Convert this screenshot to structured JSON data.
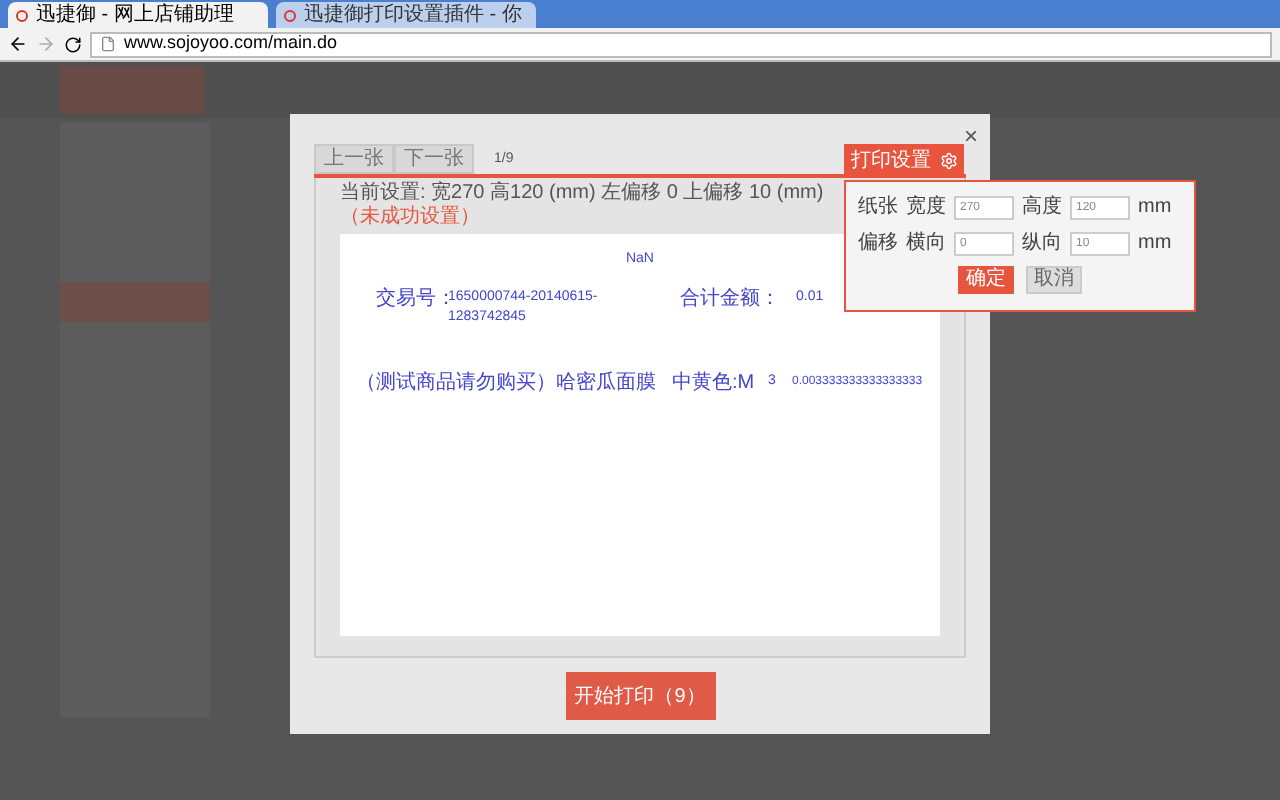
{
  "browser": {
    "tabs": [
      {
        "title": "迅捷御 - 网上店铺助理",
        "selected": true
      },
      {
        "title": "迅捷御打印设置插件 - 你",
        "selected": false
      }
    ],
    "url": "www.sojoyoo.com/main.do"
  },
  "dialog": {
    "close": "×",
    "pager": {
      "prev": "上一张",
      "next": "下一张",
      "position": "1/9"
    },
    "print_settings_button": "打印设置",
    "current_settings": {
      "text": "当前设置:  宽270 高120 (mm)    左偏移 0 上偏移 10 (mm)",
      "status": "（未成功设置）"
    },
    "preview": {
      "title": "NaN",
      "trade_label": "交易号：",
      "trade_no": "1650000744-20140615-1283742845",
      "total_label": "合计金额：",
      "total": "0.01",
      "items": [
        {
          "name": "（测试商品请勿购买）哈密瓜面膜",
          "sku": "中黄色:M",
          "qty": "3",
          "price": "0.003333333333333333"
        }
      ]
    },
    "settings_popup": {
      "rows": [
        {
          "label": "纸张",
          "f1_label": "宽度",
          "f1_value": "270",
          "f2_label": "高度",
          "f2_value": "120",
          "unit": "mm"
        },
        {
          "label": "偏移",
          "f1_label": "横向",
          "f1_value": "0",
          "f2_label": "纵向",
          "f2_value": "10",
          "unit": "mm"
        }
      ],
      "ok": "确定",
      "cancel": "取消"
    },
    "start_print": "开始打印（9）"
  }
}
